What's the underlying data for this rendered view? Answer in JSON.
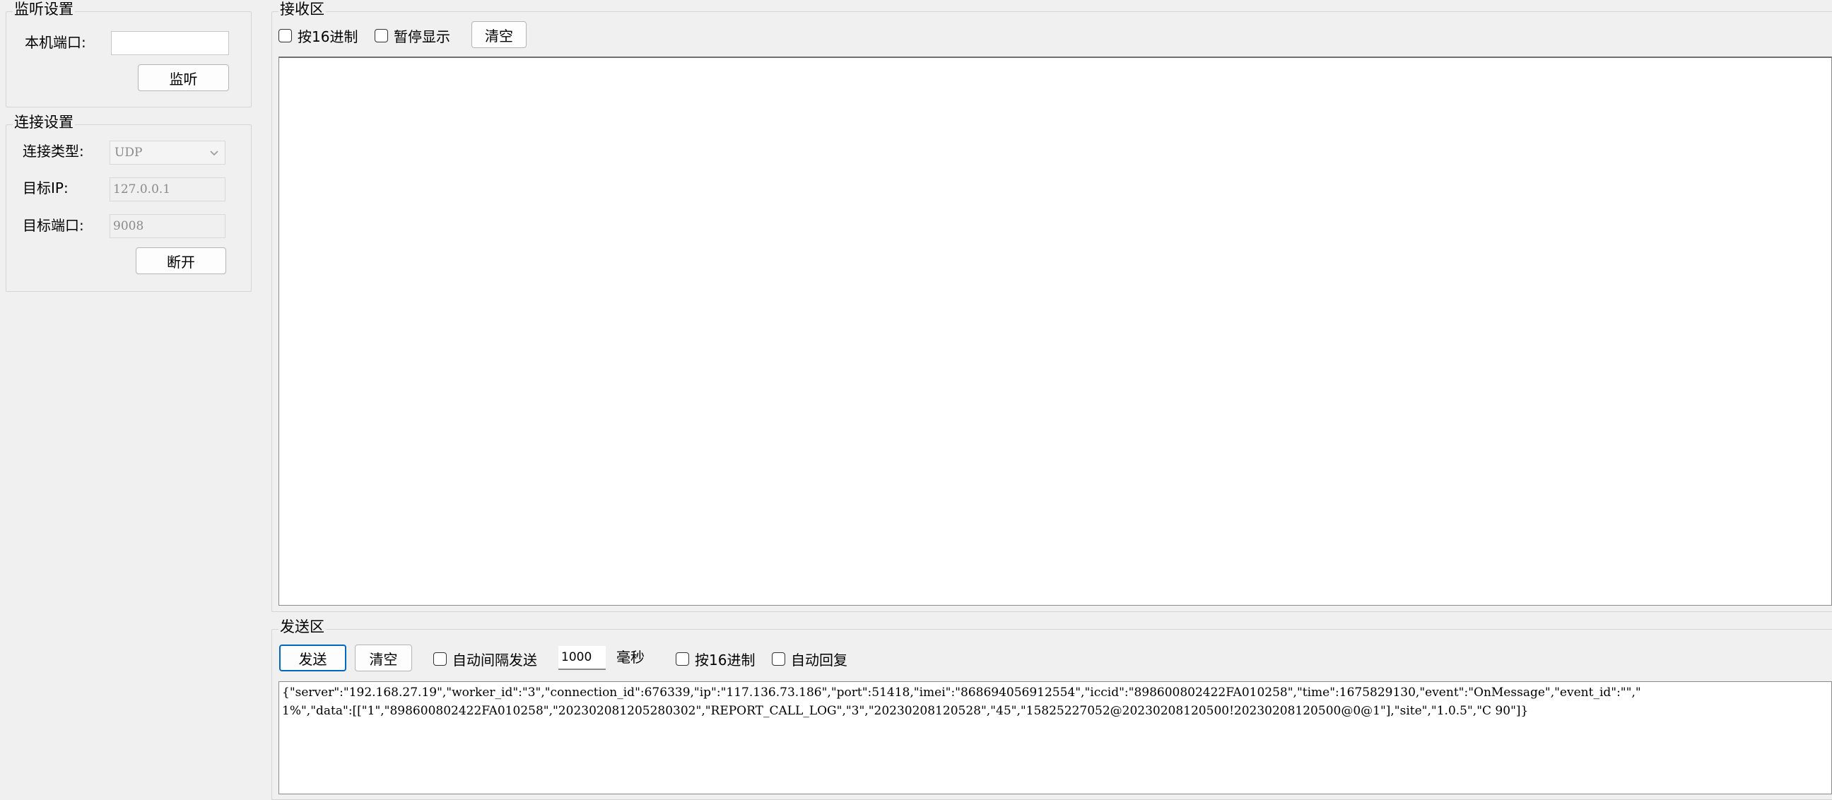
{
  "listen_settings": {
    "title": "监听设置",
    "local_port_label": "本机端口:",
    "local_port_value": "",
    "listen_button": "监听"
  },
  "connection_settings": {
    "title": "连接设置",
    "type_label": "连接类型:",
    "type_value": "UDP",
    "target_ip_label": "目标IP:",
    "target_ip_value": "127.0.0.1",
    "target_port_label": "目标端口:",
    "target_port_value": "9008",
    "disconnect_button": "断开"
  },
  "receive": {
    "title": "接收区",
    "hex_label": "按16进制",
    "pause_label": "暂停显示",
    "clear_button": "清空",
    "content": ""
  },
  "send": {
    "title": "发送区",
    "send_button": "发送",
    "clear_button": "清空",
    "auto_interval_label": "自动间隔发送",
    "interval_value": "1000",
    "interval_unit": "毫秒",
    "hex_label": "按16进制",
    "auto_reply_label": "自动回复",
    "content_line1": "{\"server\":\"192.168.27.19\",\"worker_id\":\"3\",\"connection_id\":676339,\"ip\":\"117.136.73.186\",\"port\":51418,\"imei\":\"868694056912554\",\"iccid\":\"898600802422FA010258\",\"time\":1675829130,\"event\":\"OnMessage\",\"event_id\":\"\",\"",
    "content_line2": "1%\",\"data\":[[\"1\",\"898600802422FA010258\",\"202302081205280302\",\"REPORT_CALL_LOG\",\"3\",\"20230208120528\",\"45\",\"15825227052@20230208120500!20230208120500@0@1\"],\"site\",\"1.0.5\",\"C 90\"]}"
  },
  "colors": {
    "window_bg": "#f0f0f0",
    "focus_border": "#0067c0"
  }
}
